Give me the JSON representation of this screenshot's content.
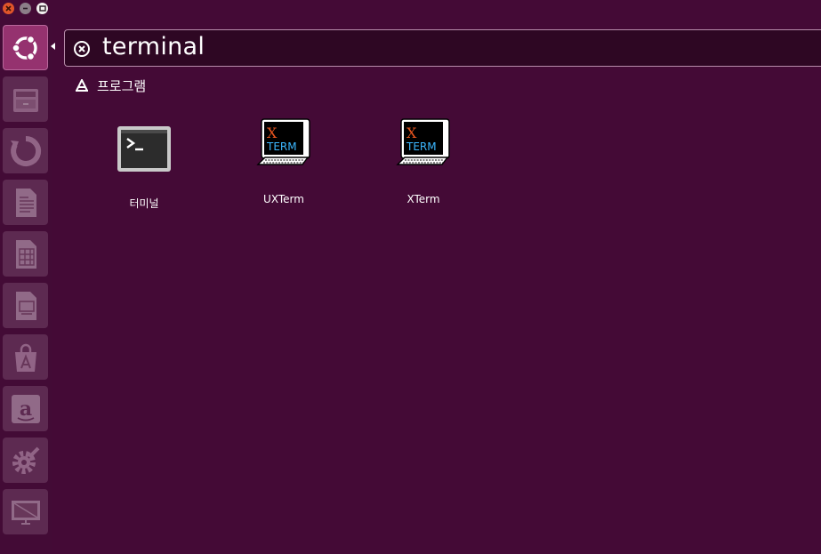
{
  "window": {
    "close_icon": "close-icon",
    "minimize_icon": "minimize-icon",
    "maximize_icon": "maximize-icon",
    "close_color": "#e0552a"
  },
  "launcher": {
    "items": [
      {
        "name": "dash-home",
        "icon": "ubuntu-logo-icon"
      },
      {
        "name": "files",
        "icon": "file-cabinet-icon"
      },
      {
        "name": "backup",
        "icon": "backup-icon"
      },
      {
        "name": "writer",
        "icon": "document-icon"
      },
      {
        "name": "calc",
        "icon": "spreadsheet-icon"
      },
      {
        "name": "impress",
        "icon": "presentation-icon"
      },
      {
        "name": "software-center",
        "icon": "shopping-bag-icon"
      },
      {
        "name": "amazon",
        "icon": "amazon-icon"
      },
      {
        "name": "settings",
        "icon": "gear-wrench-icon"
      },
      {
        "name": "workspace-switcher",
        "icon": "workspace-icon"
      }
    ]
  },
  "search": {
    "query": "terminal",
    "clear_icon": "clear-icon"
  },
  "category": {
    "label": "프로그램",
    "icon": "applications-icon"
  },
  "results": [
    {
      "label": "터미널",
      "icon": "terminal-icon"
    },
    {
      "label": "UXTerm",
      "icon": "xterm-icon"
    },
    {
      "label": "XTerm",
      "icon": "xterm-icon"
    }
  ],
  "colors": {
    "background": "#440a36",
    "accent": "#95326f"
  }
}
